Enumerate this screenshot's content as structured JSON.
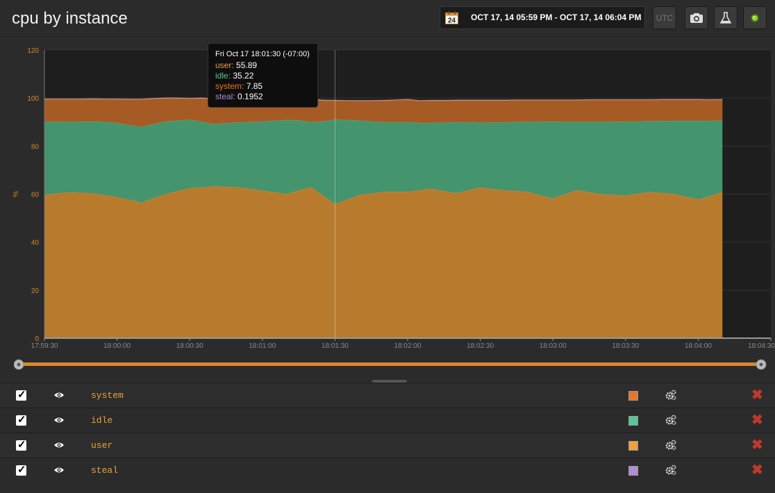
{
  "header": {
    "title": "cpu by instance",
    "date_range": "OCT 17, 14 05:59 PM - OCT 17, 14 06:04 PM",
    "calendar_day": "24",
    "utc_label": "UTC"
  },
  "tooltip": {
    "time": "Fri Oct 17 18:01:30 (-07:00)",
    "rows": [
      {
        "name": "user",
        "value": "55.89",
        "color": "#f0a040"
      },
      {
        "name": "idle",
        "value": "35.22",
        "color": "#56c895"
      },
      {
        "name": "system",
        "value": "7.85",
        "color": "#e8762a"
      },
      {
        "name": "steal",
        "value": "0.1952",
        "color": "#b58ad6"
      }
    ]
  },
  "chart_data": {
    "type": "area",
    "stacked": true,
    "ylabel": "%",
    "ylim": [
      0,
      120
    ],
    "yticks": [
      0,
      20,
      40,
      60,
      80,
      100,
      120
    ],
    "xticks": [
      "17:59:30",
      "18:00:00",
      "18:00:30",
      "18:01:00",
      "18:01:30",
      "18:02:00",
      "18:02:30",
      "18:03:00",
      "18:03:30",
      "18:04:00",
      "18:04:30"
    ],
    "x": [
      "17:59:30",
      "17:59:35",
      "17:59:40",
      "17:59:45",
      "17:59:50",
      "17:59:55",
      "18:00:00",
      "18:00:05",
      "18:00:10",
      "18:00:15",
      "18:00:20",
      "18:00:25",
      "18:00:30",
      "18:00:35",
      "18:00:40",
      "18:00:45",
      "18:00:50",
      "18:00:55",
      "18:01:00",
      "18:01:05",
      "18:01:10",
      "18:01:15",
      "18:01:20",
      "18:01:25",
      "18:01:30",
      "18:01:35",
      "18:01:40",
      "18:01:45",
      "18:01:50",
      "18:01:55",
      "18:02:00",
      "18:02:05",
      "18:02:10",
      "18:02:15",
      "18:02:20",
      "18:02:25",
      "18:02:30",
      "18:02:35",
      "18:02:40",
      "18:02:45",
      "18:02:50",
      "18:02:55",
      "18:03:00",
      "18:03:05",
      "18:03:10",
      "18:03:15",
      "18:03:20",
      "18:03:25",
      "18:03:30",
      "18:03:35",
      "18:03:40",
      "18:03:45",
      "18:03:50",
      "18:03:55",
      "18:04:00",
      "18:04:05",
      "18:04:10"
    ],
    "series": [
      {
        "name": "user",
        "color": "#b87b2d",
        "values": [
          59.8,
          60.3,
          60.8,
          60.6,
          60.3,
          59.6,
          58.8,
          57.7,
          56.5,
          58.3,
          60.0,
          61.3,
          62.5,
          62.8,
          63.2,
          63.1,
          62.9,
          62.2,
          61.5,
          60.8,
          60.1,
          61.5,
          63.0,
          59.5,
          55.89,
          57.8,
          59.7,
          60.3,
          61.0,
          61.0,
          61.0,
          61.7,
          62.3,
          61.3,
          60.4,
          61.6,
          62.8,
          62.2,
          61.6,
          61.3,
          60.9,
          59.5,
          58.2,
          60.0,
          61.7,
          60.8,
          60.0,
          59.7,
          59.5,
          60.2,
          60.9,
          60.5,
          60.1,
          59.0,
          57.8,
          59.2,
          60.9
        ]
      },
      {
        "name": "idle",
        "color": "#44946e",
        "values": [
          30.3,
          29.8,
          29.4,
          29.6,
          30.0,
          30.5,
          30.9,
          31.1,
          31.5,
          30.9,
          30.3,
          29.4,
          28.5,
          27.4,
          26.0,
          26.5,
          27.0,
          27.9,
          28.8,
          29.8,
          30.8,
          29.3,
          27.0,
          30.8,
          35.22,
          33.1,
          31.0,
          30.0,
          29.0,
          29.0,
          29.0,
          28.0,
          27.4,
          28.5,
          29.6,
          28.4,
          27.0,
          27.7,
          28.3,
          28.8,
          29.3,
          30.7,
          32.1,
          30.2,
          28.4,
          29.4,
          30.2,
          30.5,
          30.8,
          30.1,
          29.5,
          30.0,
          30.5,
          31.6,
          32.8,
          31.3,
          29.8
        ]
      },
      {
        "name": "system",
        "color": "#a75b24",
        "values": [
          9.4,
          9.4,
          9.3,
          9.3,
          9.3,
          9.4,
          9.8,
          10.6,
          11.4,
          10.5,
          9.6,
          9.2,
          8.8,
          9.7,
          10.4,
          10.1,
          9.9,
          9.8,
          9.4,
          8.8,
          8.2,
          8.9,
          9.4,
          8.7,
          7.85,
          7.9,
          8.1,
          8.5,
          8.9,
          9.1,
          9.3,
          9.1,
          9.2,
          9.1,
          9.0,
          9.0,
          9.2,
          9.1,
          9.1,
          9.0,
          8.9,
          8.9,
          8.8,
          8.9,
          9.0,
          9.0,
          9.0,
          9.0,
          8.9,
          8.9,
          8.8,
          8.8,
          8.7,
          8.7,
          8.7,
          8.7,
          8.6
        ]
      },
      {
        "name": "steal",
        "color": "#b58ad6",
        "values": [
          0.2,
          0.2,
          0.2,
          0.2,
          0.2,
          0.2,
          0.2,
          0.2,
          0.2,
          0.2,
          0.2,
          0.2,
          0.2,
          0.2,
          0.2,
          0.2,
          0.2,
          0.2,
          0.2,
          0.2,
          0.2,
          0.2,
          0.2,
          0.2,
          0.1952,
          0.2,
          0.2,
          0.2,
          0.2,
          0.2,
          0.2,
          0.2,
          0.2,
          0.2,
          0.2,
          0.2,
          0.2,
          0.2,
          0.2,
          0.2,
          0.2,
          0.2,
          0.2,
          0.2,
          0.2,
          0.2,
          0.2,
          0.2,
          0.2,
          0.2,
          0.2,
          0.2,
          0.2,
          0.2,
          0.2,
          0.2,
          0.2
        ]
      }
    ]
  },
  "legend": [
    {
      "name": "system",
      "color": "#e8762a"
    },
    {
      "name": "idle",
      "color": "#56c895"
    },
    {
      "name": "user",
      "color": "#f0a040"
    },
    {
      "name": "steal",
      "color": "#b58ad6"
    }
  ],
  "icons": {
    "calendar": "calendar-icon",
    "camera": "camera-icon",
    "flask": "flask-icon",
    "status": "status-light-icon",
    "visibility": "eye-icon",
    "settings": "gears-icon",
    "delete": "delete-icon"
  },
  "status_color": "#8fd629",
  "accent_color": "#d8892b"
}
